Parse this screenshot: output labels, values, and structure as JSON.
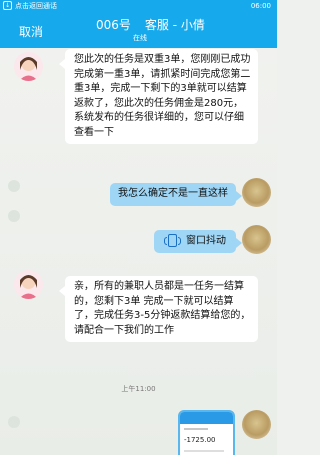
{
  "status_bar": {
    "icon": "↓",
    "text": "点击返回通话",
    "time": "06:00"
  },
  "header": {
    "back_label": "取消",
    "title_id": "006号",
    "title_name": "客服 - 小倩",
    "subtitle": "在线"
  },
  "messages": {
    "m1": "您此次的任务是双重3单，您刚刚已成功完成第一重3单，请抓紧时间完成您第二重3单，完成一下剩下的3单就可以结算返款了，您此次的任务佣金是280元，系统发布的任务很详细的，您可以仔细查看一下",
    "m2": "我怎么确定不是一直这样",
    "m3": "窗口抖动",
    "m4": "亲，所有的兼职人员都是一任务一结算的，您剩下3单 完成一下就可以结算了，完成任务3-5分钟返款结算给您的，请配合一下我们的工作",
    "time_separator": "上午11:00",
    "image_amount": "-1725.00"
  },
  "colors": {
    "header": "#16a9ec",
    "user_bubble": "#9fd6f5",
    "agent_bubble": "#ffffff",
    "background": "#eef1ee"
  }
}
